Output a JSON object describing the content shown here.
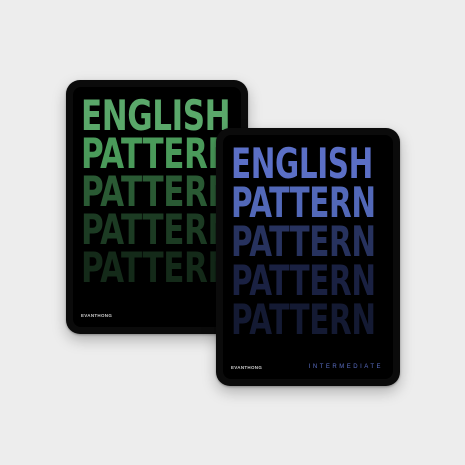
{
  "books": [
    {
      "lines": [
        "ENGLISH",
        "PATTERN",
        "PATTERN",
        "PATTERN",
        "PATTERN"
      ],
      "colors": [
        "#5aa86a",
        "#4a9a5a",
        "#2a5a34",
        "#1c3b23",
        "#142a19"
      ],
      "brand": "EVANTHONG",
      "corner": "◎"
    },
    {
      "lines": [
        "ENGLISH",
        "PATTERN",
        "PATTERN",
        "PATTERN",
        "PATTERN"
      ],
      "colors": [
        "#5b6fc6",
        "#5268b8",
        "#27325e",
        "#1a2142",
        "#141a33"
      ],
      "brand": "EVANTHONG",
      "level": "INTERMEDIATE"
    }
  ]
}
